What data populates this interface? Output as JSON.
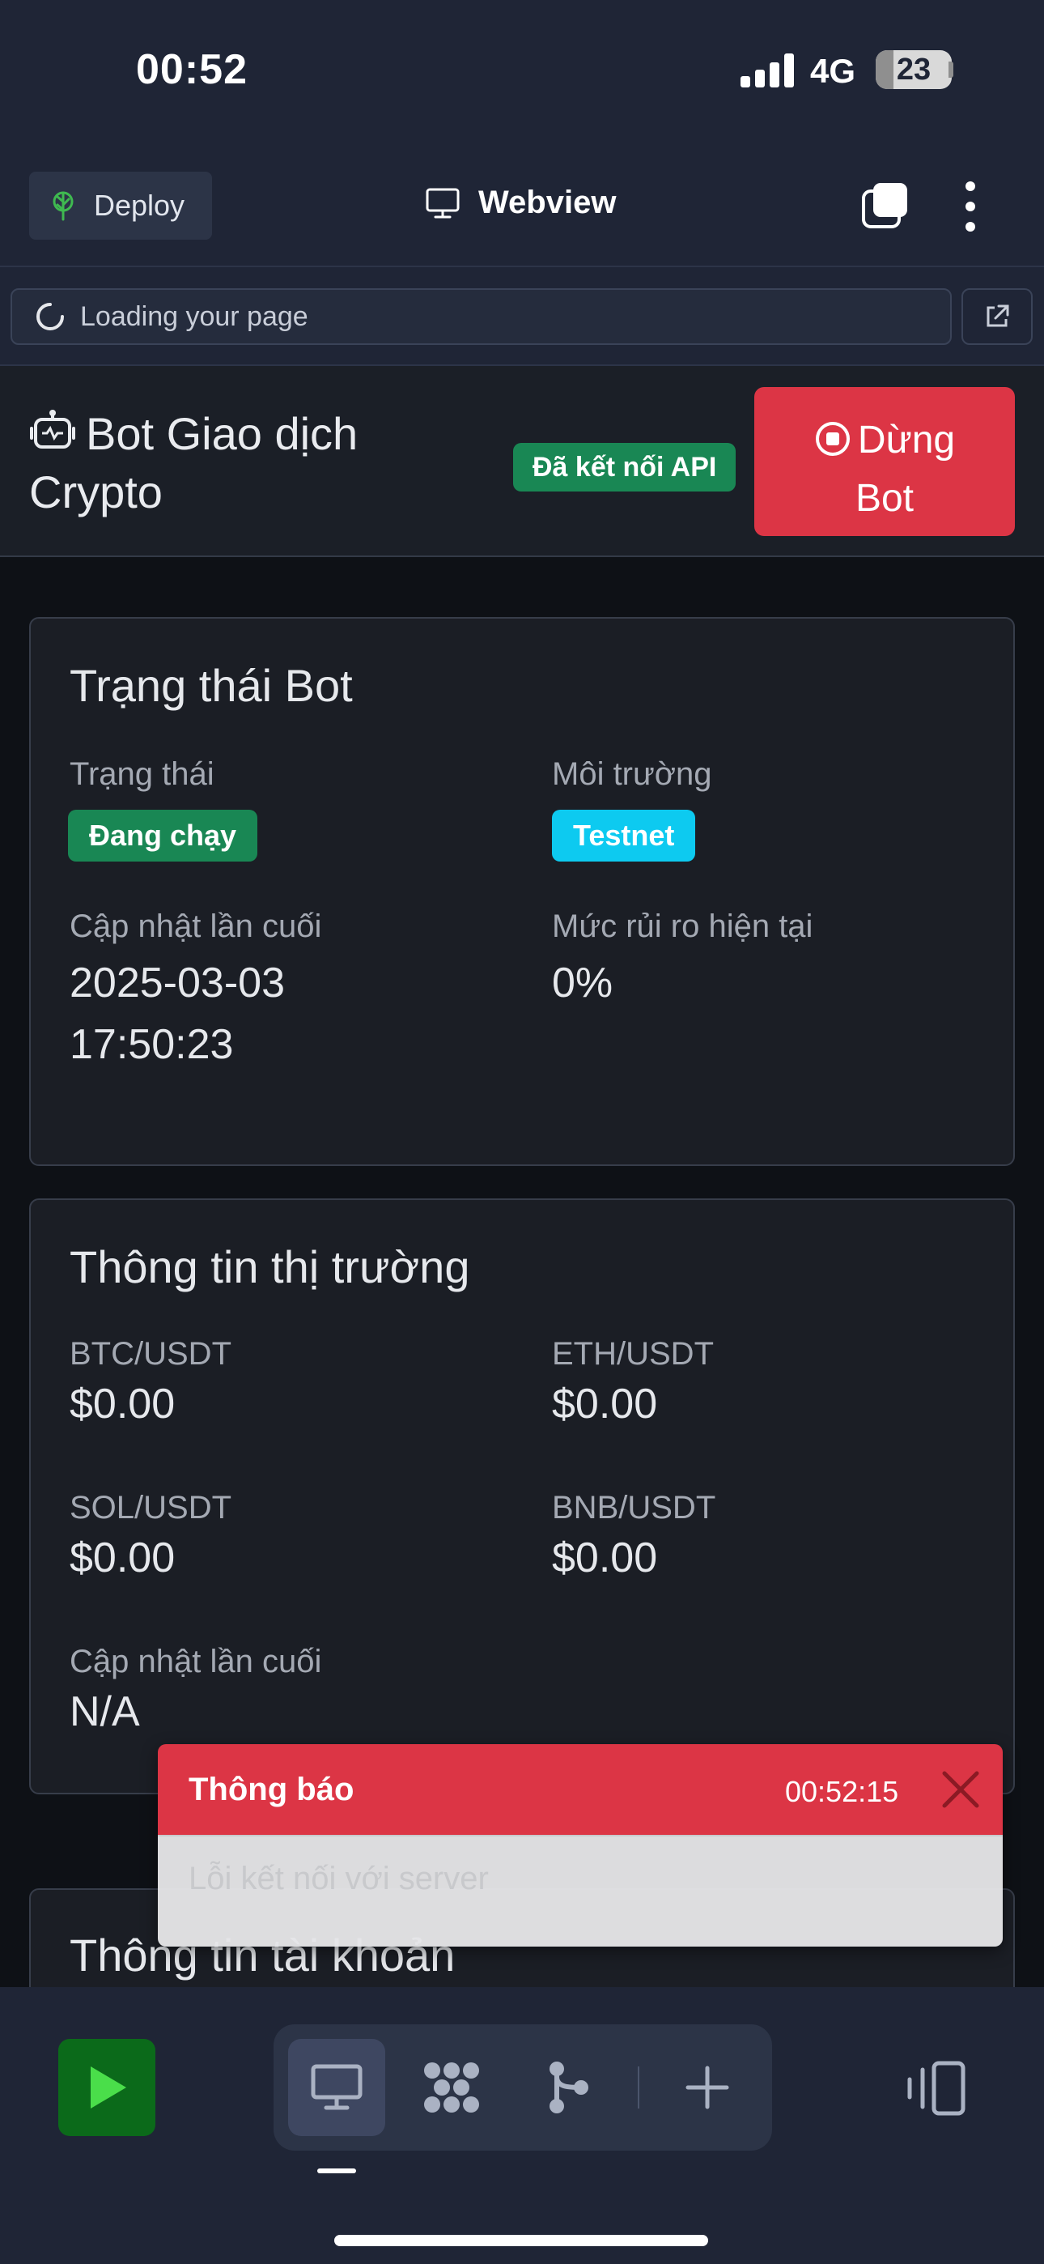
{
  "status_bar": {
    "time": "00:52",
    "network": "4G",
    "battery_level": 23,
    "battery_label": "23"
  },
  "replit_header": {
    "deploy_label": "Deploy",
    "webview_label": "Webview"
  },
  "url_bar": {
    "text": "Loading your page"
  },
  "app_header": {
    "title": "Bot Giao dịch Crypto",
    "api_badge": "Đã kết nối API",
    "stop_button_line1": "Dừng",
    "stop_button_line2": "Bot"
  },
  "bot_status_card": {
    "title": "Trạng thái Bot",
    "status_label": "Trạng thái",
    "status_value": "Đang chạy",
    "env_label": "Môi trường",
    "env_value": "Testnet",
    "updated_label": "Cập nhật lần cuối",
    "updated_date": "2025-03-03",
    "updated_time": "17:50:23",
    "risk_label": "Mức rủi ro hiện tại",
    "risk_value": "0%"
  },
  "market_card": {
    "title": "Thông tin thị trường",
    "pairs": [
      {
        "label": "BTC/USDT",
        "price": "$0.00"
      },
      {
        "label": "ETH/USDT",
        "price": "$0.00"
      },
      {
        "label": "SOL/USDT",
        "price": "$0.00"
      },
      {
        "label": "BNB/USDT",
        "price": "$0.00"
      }
    ],
    "updated_label": "Cập nhật lần cuối",
    "updated_value": "N/A"
  },
  "account_card": {
    "title": "Thông tin tài khoản"
  },
  "toast": {
    "title": "Thông báo",
    "time": "00:52:15",
    "message": "Lỗi kết nối với server"
  },
  "colors": {
    "danger": "#dc3545",
    "success": "#198754",
    "info": "#0dcaf0",
    "chrome_bg": "#1f2536",
    "page_bg": "#0e1116"
  },
  "icons": {
    "deploy": "deploy-tree-icon",
    "webview": "monitor-icon",
    "tabs": "tabs-icon",
    "menu": "kebab-menu-icon",
    "loading": "spinner-icon",
    "open_new": "external-link-icon",
    "robot": "robot-icon",
    "stop": "stop-circle-icon",
    "close": "close-icon",
    "run": "play-icon",
    "dock": [
      "monitor-icon",
      "packages-icon",
      "git-icon",
      "plus-icon"
    ],
    "device": "device-rotate-icon"
  }
}
